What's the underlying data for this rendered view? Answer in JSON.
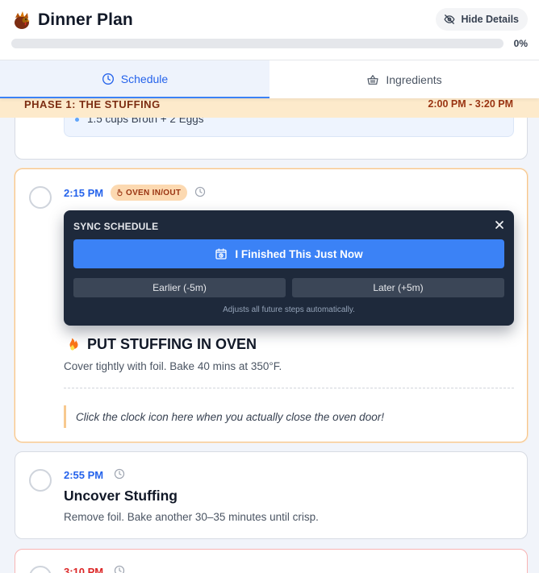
{
  "header": {
    "title": "Dinner Plan",
    "hide_details_label": "Hide Details",
    "progress_percent": 0,
    "progress_text": "0%"
  },
  "tabs": [
    {
      "label": "Schedule",
      "active": true
    },
    {
      "label": "Ingredients",
      "active": false
    }
  ],
  "phase": {
    "title": "PHASE 1: THE STUFFING",
    "time_range": "2:00 PM - 3:20 PM"
  },
  "previous_step": {
    "note_item": "1.5 cups Broth + 2 Eggs"
  },
  "active_step": {
    "time": "2:15 PM",
    "badge": "OVEN IN/OUT",
    "title": "PUT STUFFING IN OVEN",
    "description": "Cover tightly with foil. Bake 40 mins at 350°F.",
    "tip": "Click the clock icon here when you actually close the oven door!"
  },
  "sync_panel": {
    "title": "SYNC SCHEDULE",
    "primary_label": "I Finished This Just Now",
    "earlier_label": "Earlier (-5m)",
    "later_label": "Later (+5m)",
    "hint": "Adjusts all future steps automatically."
  },
  "next_step": {
    "time": "2:55 PM",
    "title": "Uncover Stuffing",
    "description": "Remove foil. Bake another 30–35 minutes until crisp."
  },
  "last_step": {
    "time": "3:10 PM"
  },
  "colors": {
    "accent": "#3b82f6",
    "phase_bg": "#fdeacb",
    "badge_bg": "#fcd9b1",
    "sync_panel_bg": "#1e293b",
    "alert_border": "#f8b4b4"
  },
  "icons": {
    "logo": "turkey-icon",
    "hide": "eye-off-icon",
    "schedule_tab": "clock-icon",
    "ingredients_tab": "basket-icon",
    "badge": "hand-pointer-icon",
    "primary": "alarm-clock-icon",
    "title": "fire-icon"
  }
}
